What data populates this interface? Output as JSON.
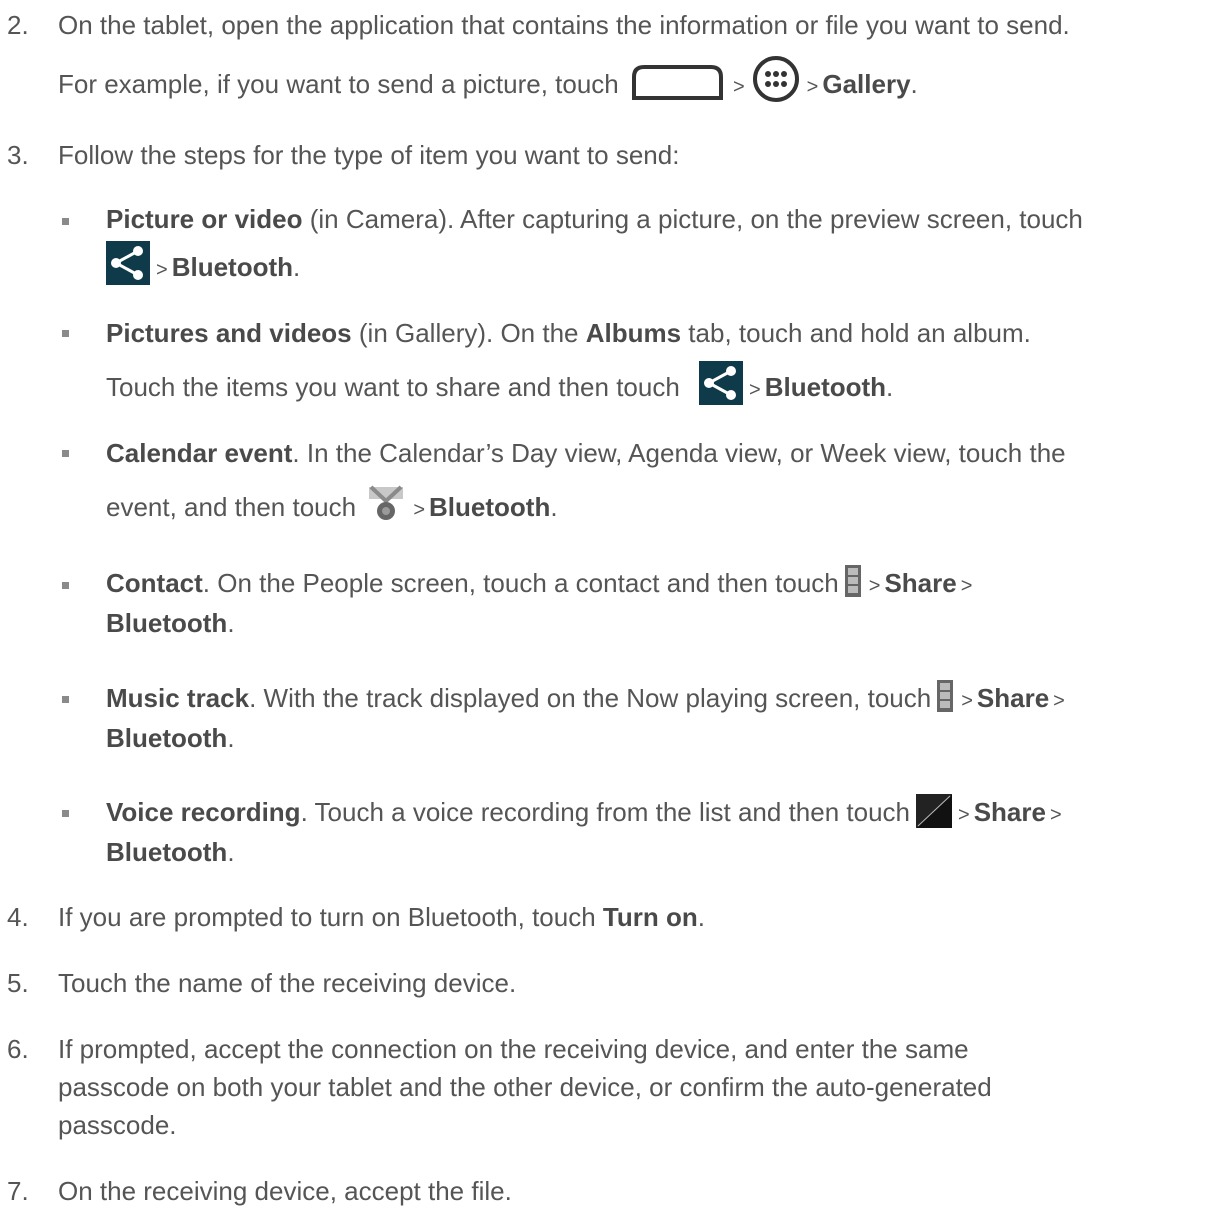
{
  "steps": [
    {
      "number": "2.",
      "text": "On the tablet, open the application that contains the information or file you want to send."
    },
    {
      "number": "3.",
      "text": "Follow the steps for the type of item you want to send:"
    },
    {
      "number": "4.",
      "text_before": "If you are prompted to turn on Bluetooth, touch ",
      "bold": "Turn on",
      "text_after": "."
    },
    {
      "number": "5.",
      "text": "Touch the name of the receiving device."
    },
    {
      "number": "6.",
      "lines": [
        "If prompted, accept the connection on the receiving device, and enter the same",
        "passcode on both your tablet and the other device, or confirm the auto-generated",
        "passcode."
      ]
    },
    {
      "number": "7.",
      "text": "On the receiving device, accept the file."
    }
  ],
  "example": {
    "before": "For example, if you want to send a picture, touch",
    "sep": ">",
    "gallery": "Gallery",
    "period": "."
  },
  "bullets": {
    "picture": {
      "title": "Picture or video",
      "line1": " (in Camera). After capturing a picture, on the preview screen, touch",
      "sep": ">",
      "target": "Bluetooth",
      "period": "."
    },
    "pictures": {
      "title": "Pictures and videos",
      "mid1": " (in Gallery). On the ",
      "albums": "Albums",
      "mid2": " tab, touch and hold an album.",
      "line2": "Touch the items you want to share and then touch",
      "sep": ">",
      "target": "Bluetooth",
      "period": "."
    },
    "calendar": {
      "title": "Calendar event",
      "line1": ". In the Calendar’s Day view, Agenda view, or Week view, touch the",
      "line2": "event, and then touch",
      "sep": ">",
      "target": "Bluetooth",
      "period": "."
    },
    "contact": {
      "title": "Contact",
      "line1": ". On the People screen, touch a contact and then touch",
      "sep": ">",
      "share": "Share",
      "sep2": ">",
      "target": "Bluetooth",
      "period": "."
    },
    "music": {
      "title": "Music track",
      "line1": ". With the track displayed on the Now playing screen, touch",
      "sep": ">",
      "share": "Share",
      "sep2": ">",
      "target": "Bluetooth",
      "period": "."
    },
    "voice": {
      "title": "Voice recording",
      "line1": ". Touch a voice recording from the list and then touch",
      "sep": ">",
      "share": "Share",
      "sep2": ">",
      "target": "Bluetooth",
      "period": "."
    }
  },
  "icons": {
    "home": "home-icon",
    "apps": "apps-icon",
    "share": "share-icon",
    "calendar_share": "calendar-share-icon",
    "menu": "menu-icon",
    "voice_menu": "voice-menu-icon"
  },
  "colors": {
    "text": "#555555",
    "share_icon_bg": "#0f3a4a"
  }
}
